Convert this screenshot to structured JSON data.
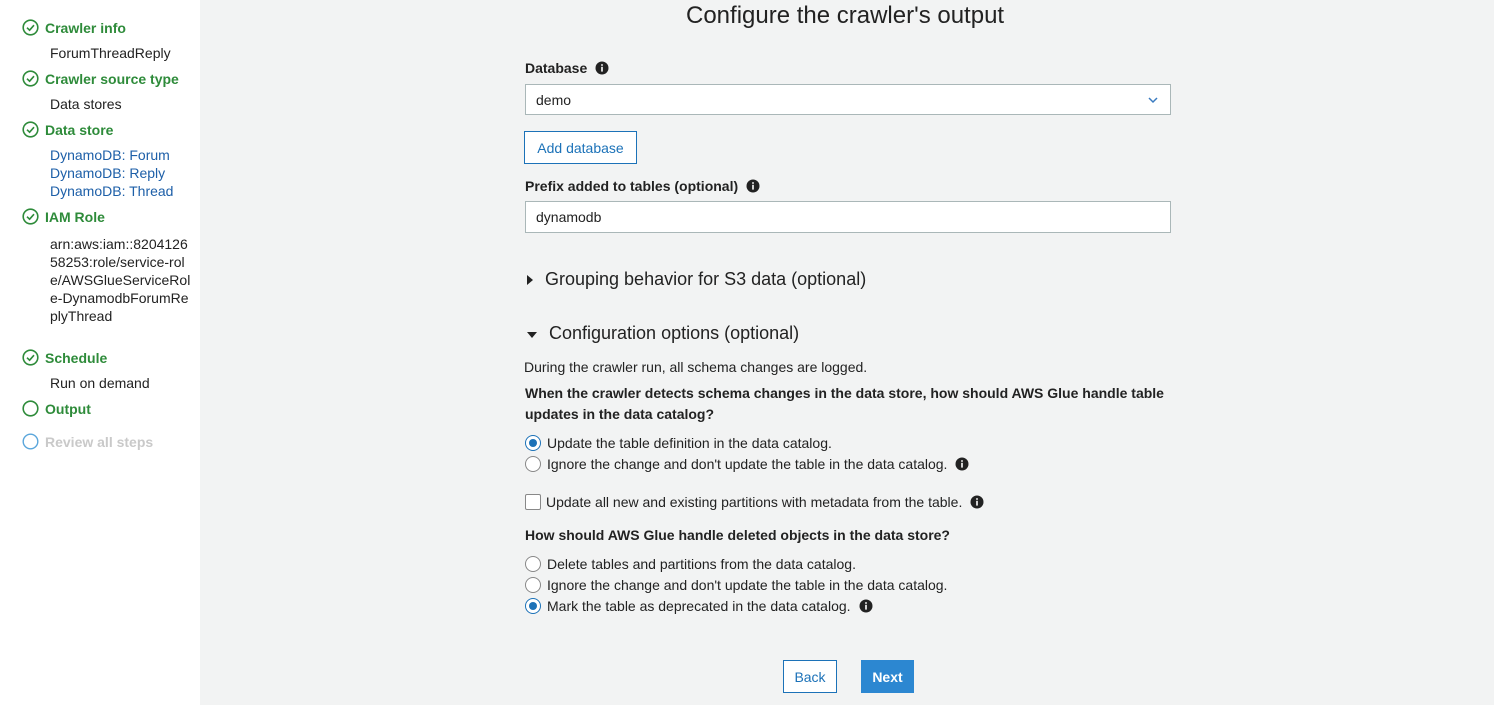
{
  "sidebar": {
    "steps": [
      {
        "title": "Crawler info",
        "status": "complete",
        "values": [
          "ForumThreadReply"
        ]
      },
      {
        "title": "Crawler source type",
        "status": "complete",
        "values": [
          "Data stores"
        ]
      },
      {
        "title": "Data store",
        "status": "complete",
        "links": [
          "DynamoDB: Forum",
          "DynamoDB: Reply",
          "DynamoDB: Thread"
        ]
      },
      {
        "title": "IAM Role",
        "status": "complete",
        "values": [
          "arn:aws:iam::820412658253:role/service-role/AWSGlueServiceRole-DynamodbForumReplyThread"
        ]
      },
      {
        "title": "Schedule",
        "status": "complete",
        "values": [
          "Run on demand"
        ]
      },
      {
        "title": "Output",
        "status": "current"
      },
      {
        "title": "Review all steps",
        "status": "pending"
      }
    ]
  },
  "main": {
    "title": "Configure the crawler's output",
    "database": {
      "label": "Database",
      "value": "demo"
    },
    "add_database_label": "Add database",
    "prefix": {
      "label": "Prefix added to tables (optional)",
      "value": "dynamodb"
    },
    "grouping": {
      "label": "Grouping behavior for S3 data (optional)",
      "expanded": false
    },
    "config": {
      "label": "Configuration options (optional)",
      "expanded": true,
      "note": "During the crawler run, all schema changes are logged.",
      "schema_question": "When the crawler detects schema changes in the data store, how should AWS Glue handle table updates in the data catalog?",
      "schema_options": [
        {
          "label": "Update the table definition in the data catalog.",
          "selected": true
        },
        {
          "label": "Ignore the change and don't update the table in the data catalog.",
          "selected": false
        }
      ],
      "partitions_checkbox": {
        "label": "Update all new and existing partitions with metadata from the table.",
        "checked": false
      },
      "delete_question": "How should AWS Glue handle deleted objects in the data store?",
      "delete_options": [
        {
          "label": "Delete tables and partitions from the data catalog.",
          "selected": false
        },
        {
          "label": "Ignore the change and don't update the table in the data catalog.",
          "selected": false
        },
        {
          "label": "Mark the table as deprecated in the data catalog.",
          "selected": true
        }
      ]
    },
    "back_label": "Back",
    "next_label": "Next"
  },
  "colors": {
    "accent": "#1c72b8",
    "primary_button": "#2c87d1",
    "success": "#2e8b3a",
    "link": "#1d5fa8",
    "background": "#f2f3f3"
  }
}
